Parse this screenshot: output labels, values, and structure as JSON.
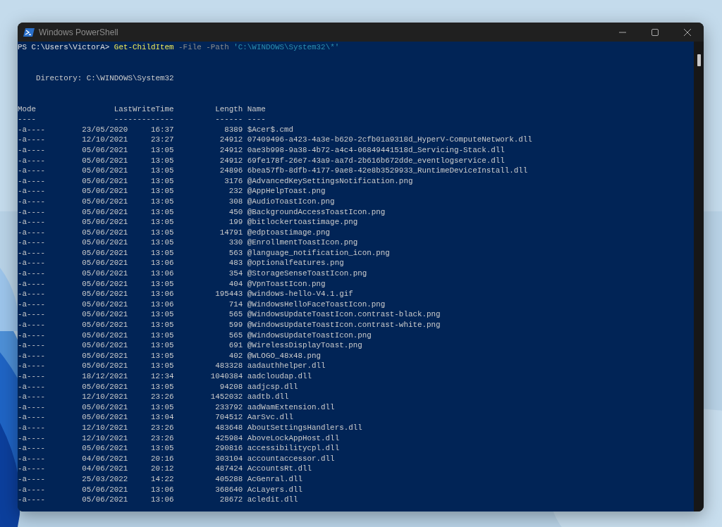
{
  "window": {
    "title": "Windows PowerShell"
  },
  "console": {
    "command": [
      {
        "kind": "prompt",
        "text": "PS C:\\Users\\VictorA>"
      },
      {
        "kind": "cmdlet",
        "text": "Get-ChildItem"
      },
      {
        "kind": "parameter",
        "text": "-File -Path"
      },
      {
        "kind": "string",
        "text": "'C:\\WINDOWS\\System32\\*'"
      }
    ],
    "directory": "Directory: C:\\WINDOWS\\System32",
    "columns": [
      {
        "heading": "Mode",
        "rule": "----"
      },
      {
        "heading": "LastWriteTime",
        "rule": "-------------"
      },
      {
        "heading": "Length",
        "rule": "------"
      },
      {
        "heading": "Name",
        "rule": "----"
      }
    ],
    "rows": [
      {
        "mode": "-a----",
        "date": "23/05/2020",
        "time": "16:37",
        "length": "8389",
        "name": "$Acer$.cmd"
      },
      {
        "mode": "-a----",
        "date": "12/10/2021",
        "time": "23:27",
        "length": "24912",
        "name": "07409496-a423-4a3e-b620-2cfb01a9318d_HyperV-ComputeNetwork.dll"
      },
      {
        "mode": "-a----",
        "date": "05/06/2021",
        "time": "13:05",
        "length": "24912",
        "name": "0ae3b998-9a38-4b72-a4c4-06849441518d_Servicing-Stack.dll"
      },
      {
        "mode": "-a----",
        "date": "05/06/2021",
        "time": "13:05",
        "length": "24912",
        "name": "69fe178f-26e7-43a9-aa7d-2b616b672dde_eventlogservice.dll"
      },
      {
        "mode": "-a----",
        "date": "05/06/2021",
        "time": "13:05",
        "length": "24896",
        "name": "6bea57fb-8dfb-4177-9ae8-42e8b3529933_RuntimeDeviceInstall.dll"
      },
      {
        "mode": "-a----",
        "date": "05/06/2021",
        "time": "13:05",
        "length": "3176",
        "name": "@AdvancedKeySettingsNotification.png"
      },
      {
        "mode": "-a----",
        "date": "05/06/2021",
        "time": "13:05",
        "length": "232",
        "name": "@AppHelpToast.png"
      },
      {
        "mode": "-a----",
        "date": "05/06/2021",
        "time": "13:05",
        "length": "308",
        "name": "@AudioToastIcon.png"
      },
      {
        "mode": "-a----",
        "date": "05/06/2021",
        "time": "13:05",
        "length": "450",
        "name": "@BackgroundAccessToastIcon.png"
      },
      {
        "mode": "-a----",
        "date": "05/06/2021",
        "time": "13:05",
        "length": "199",
        "name": "@bitlockertoastimage.png"
      },
      {
        "mode": "-a----",
        "date": "05/06/2021",
        "time": "13:05",
        "length": "14791",
        "name": "@edptoastimage.png"
      },
      {
        "mode": "-a----",
        "date": "05/06/2021",
        "time": "13:05",
        "length": "330",
        "name": "@EnrollmentToastIcon.png"
      },
      {
        "mode": "-a----",
        "date": "05/06/2021",
        "time": "13:05",
        "length": "563",
        "name": "@language_notification_icon.png"
      },
      {
        "mode": "-a----",
        "date": "05/06/2021",
        "time": "13:06",
        "length": "483",
        "name": "@optionalfeatures.png"
      },
      {
        "mode": "-a----",
        "date": "05/06/2021",
        "time": "13:06",
        "length": "354",
        "name": "@StorageSenseToastIcon.png"
      },
      {
        "mode": "-a----",
        "date": "05/06/2021",
        "time": "13:05",
        "length": "404",
        "name": "@VpnToastIcon.png"
      },
      {
        "mode": "-a----",
        "date": "05/06/2021",
        "time": "13:06",
        "length": "195443",
        "name": "@windows-hello-V4.1.gif"
      },
      {
        "mode": "-a----",
        "date": "05/06/2021",
        "time": "13:06",
        "length": "714",
        "name": "@WindowsHelloFaceToastIcon.png"
      },
      {
        "mode": "-a----",
        "date": "05/06/2021",
        "time": "13:05",
        "length": "565",
        "name": "@WindowsUpdateToastIcon.contrast-black.png"
      },
      {
        "mode": "-a----",
        "date": "05/06/2021",
        "time": "13:05",
        "length": "599",
        "name": "@WindowsUpdateToastIcon.contrast-white.png"
      },
      {
        "mode": "-a----",
        "date": "05/06/2021",
        "time": "13:05",
        "length": "565",
        "name": "@WindowsUpdateToastIcon.png"
      },
      {
        "mode": "-a----",
        "date": "05/06/2021",
        "time": "13:05",
        "length": "691",
        "name": "@WirelessDisplayToast.png"
      },
      {
        "mode": "-a----",
        "date": "05/06/2021",
        "time": "13:05",
        "length": "402",
        "name": "@WLOGO_48x48.png"
      },
      {
        "mode": "-a----",
        "date": "05/06/2021",
        "time": "13:05",
        "length": "483328",
        "name": "aadauthhelper.dll"
      },
      {
        "mode": "-a----",
        "date": "18/12/2021",
        "time": "12:34",
        "length": "1040384",
        "name": "aadcloudap.dll"
      },
      {
        "mode": "-a----",
        "date": "05/06/2021",
        "time": "13:05",
        "length": "94208",
        "name": "aadjcsp.dll"
      },
      {
        "mode": "-a----",
        "date": "12/10/2021",
        "time": "23:26",
        "length": "1452032",
        "name": "aadtb.dll"
      },
      {
        "mode": "-a----",
        "date": "05/06/2021",
        "time": "13:05",
        "length": "233792",
        "name": "aadWamExtension.dll"
      },
      {
        "mode": "-a----",
        "date": "05/06/2021",
        "time": "13:04",
        "length": "704512",
        "name": "AarSvc.dll"
      },
      {
        "mode": "-a----",
        "date": "12/10/2021",
        "time": "23:26",
        "length": "483648",
        "name": "AboutSettingsHandlers.dll"
      },
      {
        "mode": "-a----",
        "date": "12/10/2021",
        "time": "23:26",
        "length": "425984",
        "name": "AboveLockAppHost.dll"
      },
      {
        "mode": "-a----",
        "date": "05/06/2021",
        "time": "13:05",
        "length": "290816",
        "name": "accessibilitycpl.dll"
      },
      {
        "mode": "-a----",
        "date": "04/06/2021",
        "time": "20:16",
        "length": "303104",
        "name": "accountaccessor.dll"
      },
      {
        "mode": "-a----",
        "date": "04/06/2021",
        "time": "20:12",
        "length": "487424",
        "name": "AccountsRt.dll"
      },
      {
        "mode": "-a----",
        "date": "25/03/2022",
        "time": "14:22",
        "length": "405288",
        "name": "AcGenral.dll"
      },
      {
        "mode": "-a----",
        "date": "05/06/2021",
        "time": "13:06",
        "length": "368640",
        "name": "AcLayers.dll"
      },
      {
        "mode": "-a----",
        "date": "05/06/2021",
        "time": "13:06",
        "length": "28672",
        "name": "acledit.dll"
      }
    ]
  }
}
